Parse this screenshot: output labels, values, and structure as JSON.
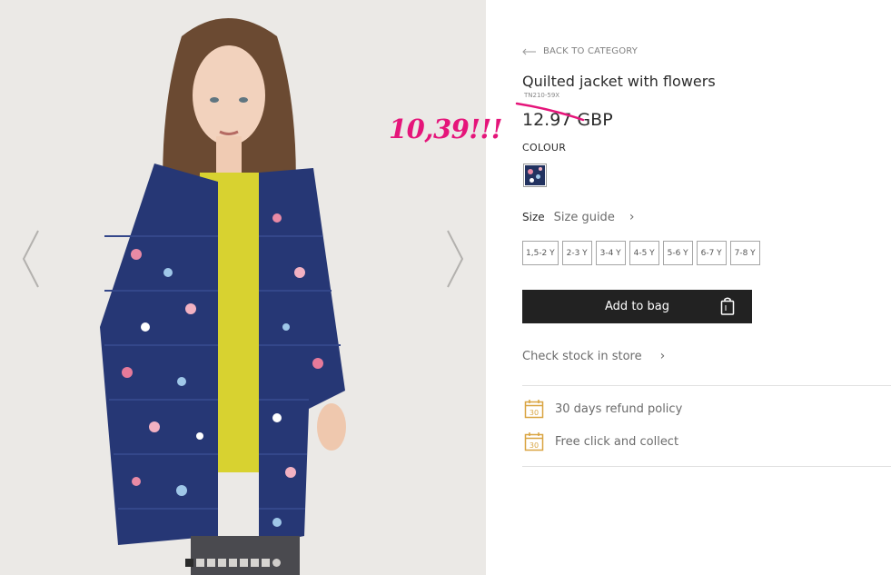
{
  "gallery": {
    "prev_icon": "chevron-left-icon",
    "next_icon": "chevron-right-icon",
    "image_count": 9,
    "active_index": 0
  },
  "product": {
    "back_label": "BACK TO CATEGORY",
    "title": "Quilted jacket with flowers",
    "sku": "TN210-59X",
    "price": "12.97 GBP",
    "colour_label": "COLOUR",
    "size_label": "Size",
    "size_guide_label": "Size guide",
    "sizes": [
      "1,5-2 Y",
      "2-3 Y",
      "3-4 Y",
      "4-5 Y",
      "5-6 Y",
      "6-7 Y",
      "7-8 Y"
    ],
    "add_to_bag_label": "Add to bag",
    "check_stock_label": "Check stock in store",
    "features": [
      {
        "icon": "calendar-30-icon",
        "label": "30 days refund policy"
      },
      {
        "icon": "calendar-30-icon",
        "label": "Free click and collect"
      }
    ],
    "calendar_number": "30"
  },
  "annotation": {
    "text": "10,39!!!",
    "color": "#e5157a"
  },
  "colors": {
    "accent_button": "#222222",
    "icon_gold": "#d9a441",
    "gallery_bg": "#ebe9e6"
  }
}
